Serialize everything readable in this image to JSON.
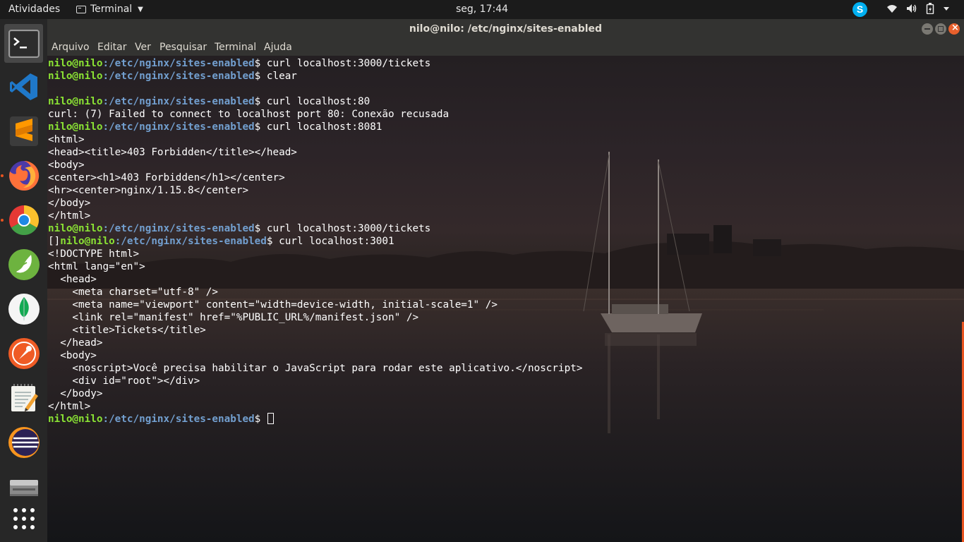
{
  "topbar": {
    "activities": "Atividades",
    "app_menu": "Terminal",
    "clock": "seg, 17:44",
    "skype_letter": "S"
  },
  "dock": {
    "items": [
      {
        "name": "terminal",
        "active": true,
        "running": false
      },
      {
        "name": "vscode",
        "running": false
      },
      {
        "name": "sublime-text",
        "running": false
      },
      {
        "name": "firefox",
        "running": true
      },
      {
        "name": "chrome",
        "running": true
      },
      {
        "name": "spring-tool-suite",
        "running": false
      },
      {
        "name": "mongodb-compass",
        "running": false
      },
      {
        "name": "postman",
        "running": false
      },
      {
        "name": "text-editor",
        "running": false
      },
      {
        "name": "eclipse",
        "running": false
      },
      {
        "name": "file-storage",
        "running": false
      },
      {
        "name": "show-applications",
        "running": false
      }
    ]
  },
  "window": {
    "title": "nilo@nilo: /etc/nginx/sites-enabled",
    "menu": [
      "Arquivo",
      "Editar",
      "Ver",
      "Pesquisar",
      "Terminal",
      "Ajuda"
    ]
  },
  "terminal": {
    "prompt_user": "nilo@nilo",
    "prompt_path": ":/etc/nginx/sites-enabled",
    "prompt_symbol": "$",
    "lines": [
      {
        "type": "prompt",
        "cmd": " curl localhost:3000/tickets"
      },
      {
        "type": "prompt",
        "cmd": " clear"
      },
      {
        "type": "text",
        "text": ""
      },
      {
        "type": "prompt",
        "cmd": " curl localhost:80"
      },
      {
        "type": "text",
        "text": "curl: (7) Failed to connect to localhost port 80: Conexão recusada"
      },
      {
        "type": "prompt",
        "cmd": " curl localhost:8081"
      },
      {
        "type": "text",
        "text": "<html>"
      },
      {
        "type": "text",
        "text": "<head><title>403 Forbidden</title></head>"
      },
      {
        "type": "text",
        "text": "<body>"
      },
      {
        "type": "text",
        "text": "<center><h1>403 Forbidden</h1></center>"
      },
      {
        "type": "text",
        "text": "<hr><center>nginx/1.15.8</center>"
      },
      {
        "type": "text",
        "text": "</body>"
      },
      {
        "type": "text",
        "text": "</html>"
      },
      {
        "type": "prompt",
        "cmd": " curl localhost:3000/tickets"
      },
      {
        "type": "prompt",
        "prefix": "[]",
        "cmd": " curl localhost:3001"
      },
      {
        "type": "text",
        "text": "<!DOCTYPE html>"
      },
      {
        "type": "text",
        "text": "<html lang=\"en\">"
      },
      {
        "type": "text",
        "text": "  <head>"
      },
      {
        "type": "text",
        "text": "    <meta charset=\"utf-8\" />"
      },
      {
        "type": "text",
        "text": "    <meta name=\"viewport\" content=\"width=device-width, initial-scale=1\" />"
      },
      {
        "type": "text",
        "text": "    <link rel=\"manifest\" href=\"%PUBLIC_URL%/manifest.json\" />"
      },
      {
        "type": "text",
        "text": "    <title>Tickets</title>"
      },
      {
        "type": "text",
        "text": "  </head>"
      },
      {
        "type": "text",
        "text": "  <body>"
      },
      {
        "type": "text",
        "text": "    <noscript>Você precisa habilitar o JavaScript para rodar este aplicativo.</noscript>"
      },
      {
        "type": "text",
        "text": "    <div id=\"root\"></div>"
      },
      {
        "type": "text",
        "text": "  </body>"
      },
      {
        "type": "text",
        "text": "</html>"
      },
      {
        "type": "prompt",
        "cmd": " ",
        "cursor": true
      }
    ]
  },
  "colors": {
    "prompt_user": "#8ae234",
    "prompt_path": "#729fcf",
    "accent": "#e95420"
  }
}
